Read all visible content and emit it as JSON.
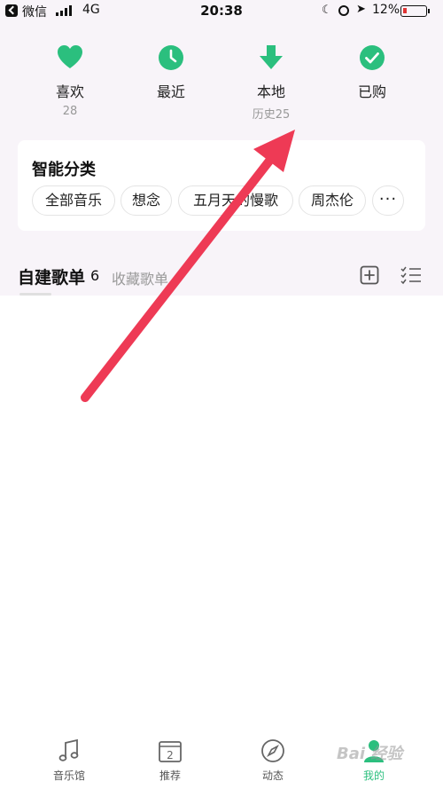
{
  "status_bar": {
    "back_app": "微信",
    "network": "4G",
    "time": "20:38",
    "battery": "12%"
  },
  "quick_access": [
    {
      "label": "喜欢",
      "count": "28",
      "icon": "heart-icon"
    },
    {
      "label": "最近",
      "count": "",
      "icon": "clock-icon"
    },
    {
      "label": "本地",
      "count": "历史25",
      "icon": "download-icon"
    },
    {
      "label": "已购",
      "count": "",
      "icon": "check-circle-icon"
    }
  ],
  "smart_categories": {
    "title": "智能分类",
    "chips": [
      "全部音乐",
      "想念",
      "五月天的慢歌",
      "周杰伦"
    ],
    "more": "···"
  },
  "playlist_tabs": {
    "own_label": "自建歌单",
    "own_count": "6",
    "collected_label": "收藏歌单"
  },
  "bottom_nav": [
    {
      "label": "音乐馆",
      "icon": "music-note-icon",
      "active": false
    },
    {
      "label": "推荐",
      "icon": "calendar-icon",
      "active": false
    },
    {
      "label": "动态",
      "icon": "compass-icon",
      "active": false
    },
    {
      "label": "我的",
      "icon": "profile-icon",
      "active": true
    }
  ],
  "calendar_day": "2",
  "watermark": "Bai 经验",
  "colors": {
    "accent": "#2bbf7e",
    "annotation_arrow": "#ee3a55",
    "header_bg": "#f8f4f9"
  }
}
